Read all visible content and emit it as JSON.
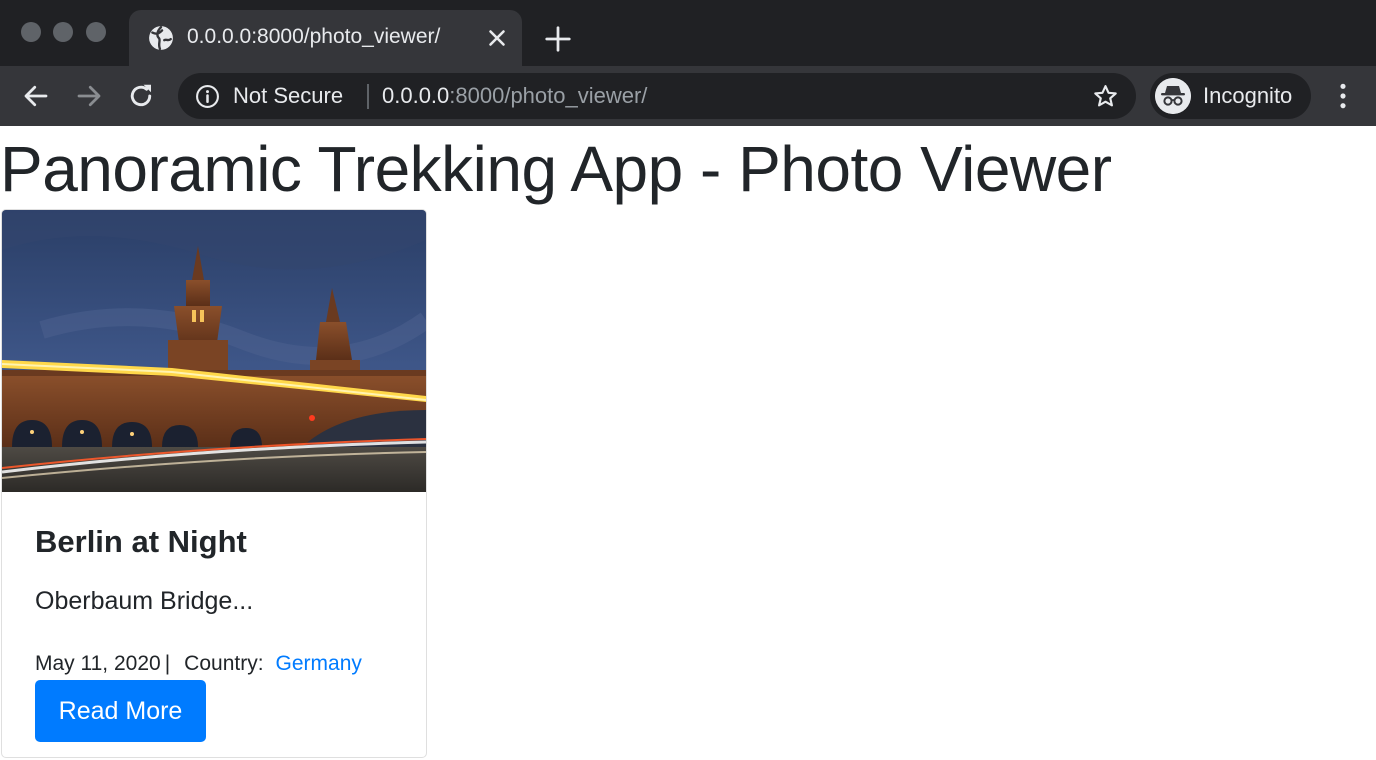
{
  "browser": {
    "tab": {
      "title": "0.0.0.0:8000/photo_viewer/",
      "favicon": "globe-icon"
    },
    "omnibox": {
      "security_label": "Not Secure",
      "url_host": "0.0.0.0",
      "url_rest": ":8000/photo_viewer/"
    },
    "profile": {
      "label": "Incognito",
      "icon": "incognito-icon"
    },
    "colors": {
      "frame": "#202124",
      "toolbar": "#35363a",
      "text": "#e8eaed"
    }
  },
  "page": {
    "title": "Panoramic Trekking App - Photo Viewer",
    "cards": [
      {
        "title": "Berlin at Night",
        "excerpt": "Oberbaum Bridge...",
        "date": "May 11, 2020",
        "separator": "|",
        "country_label": "Country:",
        "country": "Germany",
        "button_label": "Read More"
      }
    ],
    "colors": {
      "primary": "#007bff",
      "text": "#212529"
    }
  }
}
